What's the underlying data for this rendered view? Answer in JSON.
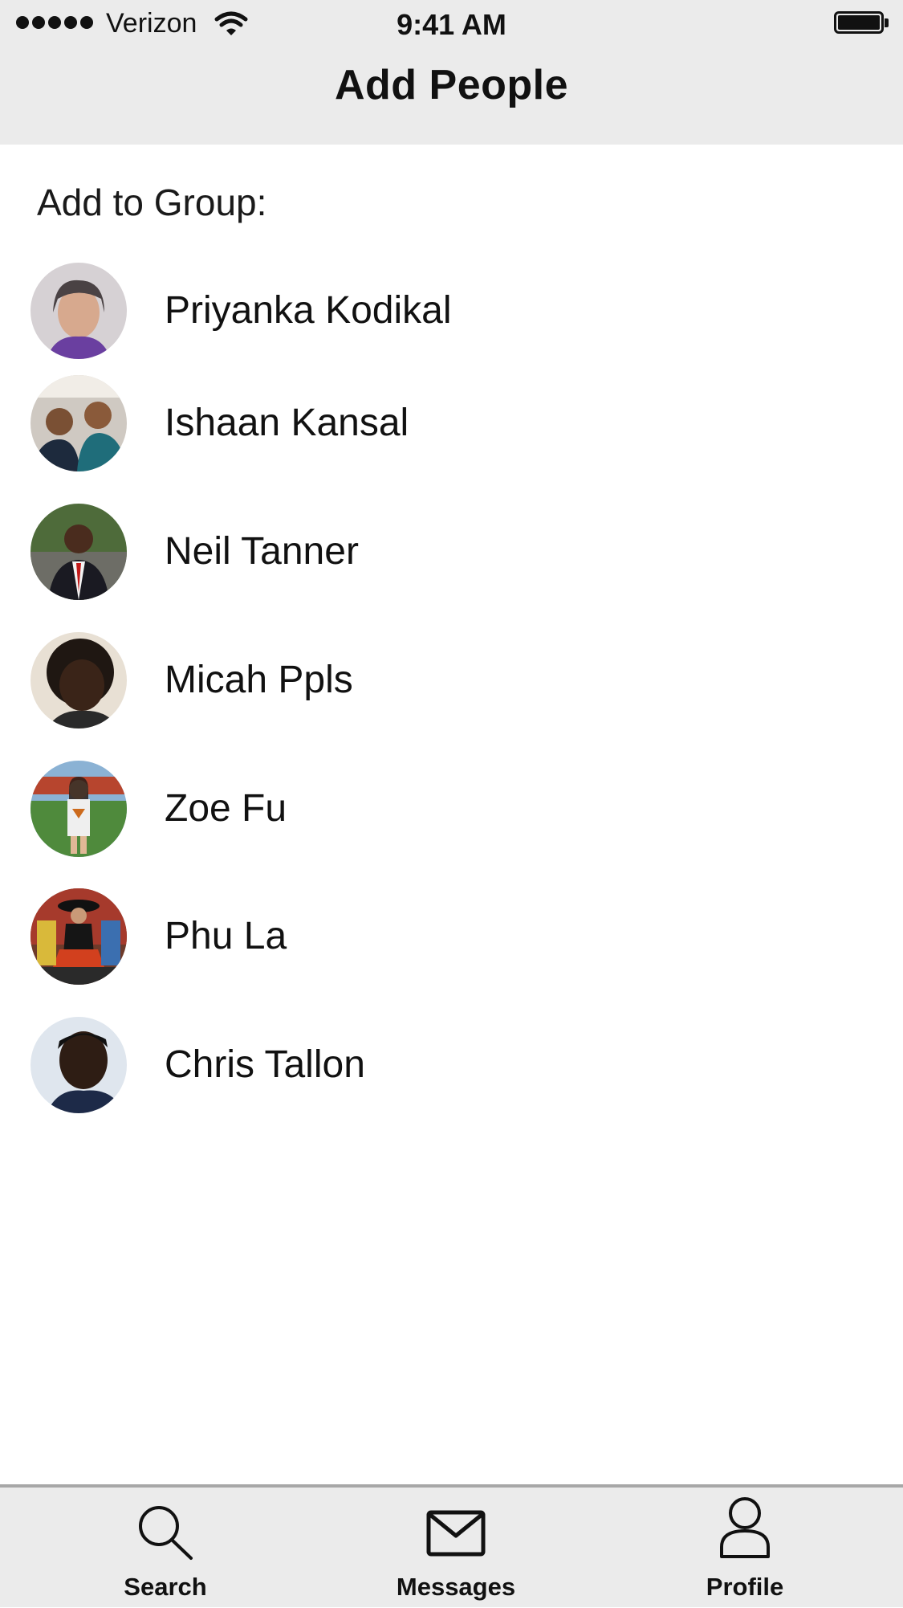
{
  "status_bar": {
    "carrier": "Verizon",
    "time": "9:41 AM"
  },
  "nav": {
    "title": "Add People"
  },
  "section": {
    "label": "Add to Group:"
  },
  "contacts": [
    {
      "name": "Priyanka Kodikal"
    },
    {
      "name": "Ishaan Kansal"
    },
    {
      "name": "Neil Tanner"
    },
    {
      "name": "Micah Ppls"
    },
    {
      "name": "Zoe Fu"
    },
    {
      "name": "Phu La"
    },
    {
      "name": "Chris Tallon"
    }
  ],
  "tabbar": {
    "search": {
      "label": "Search",
      "icon": "search-icon"
    },
    "messages": {
      "label": "Messages",
      "icon": "envelope-icon"
    },
    "profile": {
      "label": "Profile",
      "icon": "person-icon"
    }
  }
}
